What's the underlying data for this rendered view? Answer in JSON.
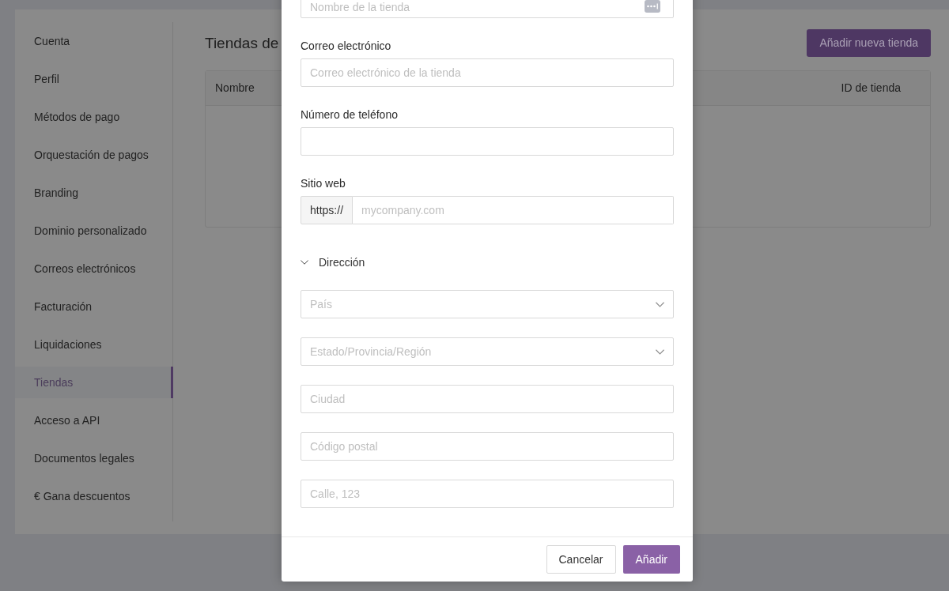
{
  "sidebar": {
    "items": [
      {
        "label": "Cuenta",
        "selected": false
      },
      {
        "label": "Perfil",
        "selected": false
      },
      {
        "label": "Métodos de pago",
        "selected": false
      },
      {
        "label": "Orquestación de pagos",
        "selected": false
      },
      {
        "label": "Branding",
        "selected": false
      },
      {
        "label": "Dominio personalizado",
        "selected": false
      },
      {
        "label": "Correos electrónicos",
        "selected": false
      },
      {
        "label": "Facturación",
        "selected": false
      },
      {
        "label": "Liquidaciones",
        "selected": false
      },
      {
        "label": "Tiendas",
        "selected": true
      },
      {
        "label": "Acceso a API",
        "selected": false
      },
      {
        "label": "Documentos legales",
        "selected": false
      },
      {
        "label": "€ Gana descuentos",
        "selected": false
      }
    ]
  },
  "page": {
    "title": "Tiendas de",
    "add_button": "Añadir nueva tienda",
    "table": {
      "columns": [
        "Nombre",
        "ID de tienda"
      ]
    }
  },
  "dialog": {
    "fields": [
      {
        "kind": "autofill",
        "placeholder": "Nombre de la tienda"
      },
      {
        "kind": "text",
        "label": "Correo electrónico",
        "placeholder": "Correo electrónico de la tienda"
      },
      {
        "kind": "text",
        "label": "Número de teléfono"
      },
      {
        "kind": "url",
        "label": "Sitio web",
        "prefix": "https://",
        "placeholder": "mycompany.com"
      }
    ],
    "address": {
      "title": "Dirección",
      "expanded": true,
      "fields": [
        {
          "kind": "select",
          "placeholder": "País"
        },
        {
          "kind": "select",
          "placeholder": "Estado/Provincia/Región"
        },
        {
          "kind": "text",
          "placeholder": "Ciudad"
        },
        {
          "kind": "text",
          "placeholder": "Código postal"
        },
        {
          "kind": "text",
          "placeholder": "Calle, 123"
        }
      ]
    },
    "buttons": [
      {
        "label": "Cancelar",
        "kind": "secondary"
      },
      {
        "label": "Añadir",
        "kind": "primary"
      }
    ]
  }
}
